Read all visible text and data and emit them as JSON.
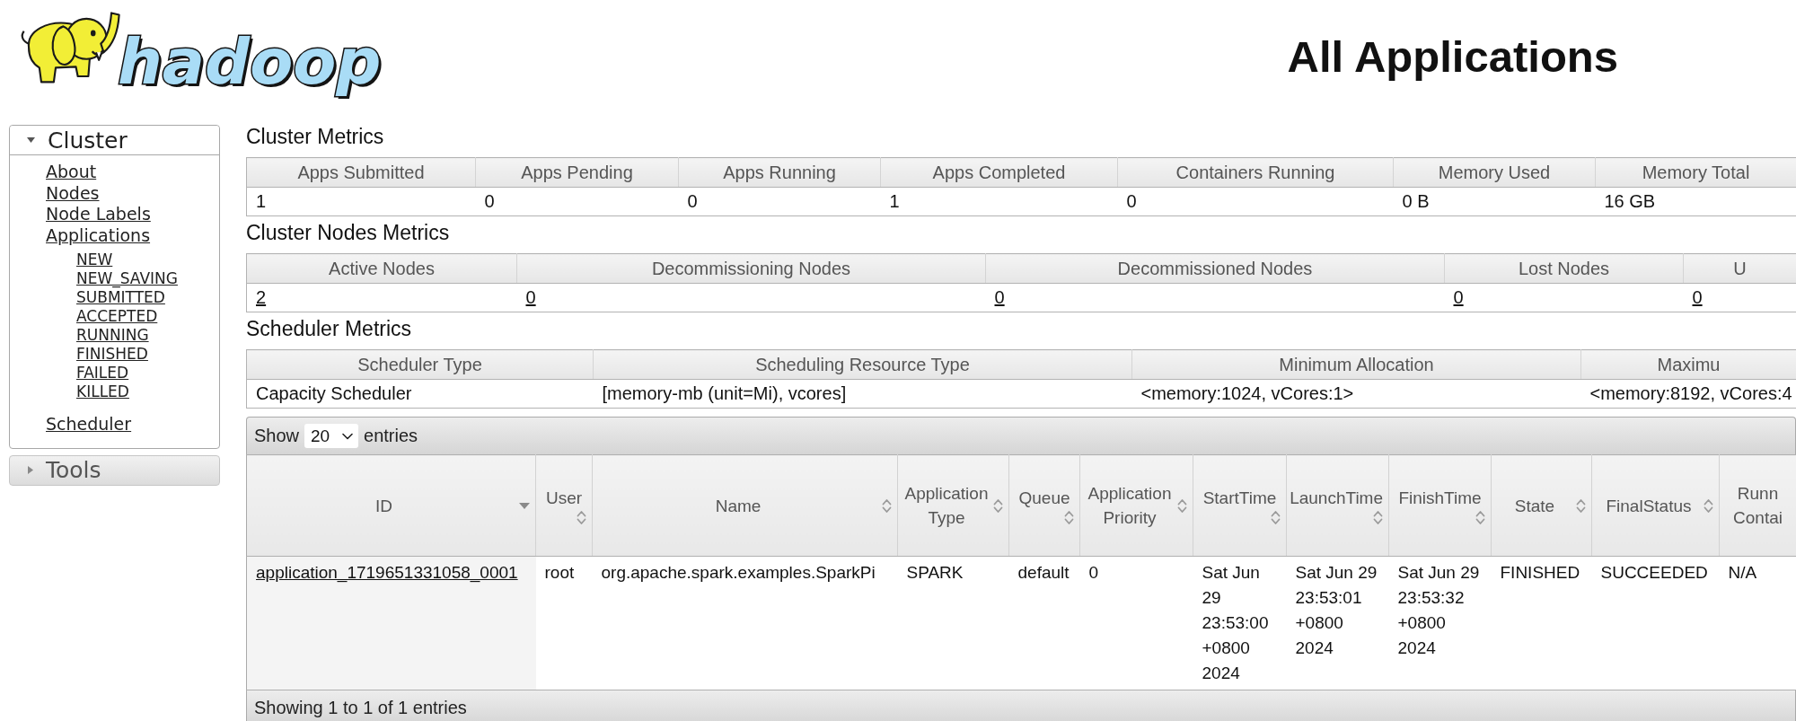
{
  "header": {
    "logo_text": "hadoop",
    "title": "All Applications"
  },
  "sidebar": {
    "sections": [
      {
        "title": "Cluster",
        "expanded": true,
        "items": [
          {
            "label": "About"
          },
          {
            "label": "Nodes"
          },
          {
            "label": "Node Labels"
          },
          {
            "label": "Applications",
            "children": [
              {
                "label": "NEW"
              },
              {
                "label": "NEW_SAVING"
              },
              {
                "label": "SUBMITTED"
              },
              {
                "label": "ACCEPTED"
              },
              {
                "label": "RUNNING"
              },
              {
                "label": "FINISHED"
              },
              {
                "label": "FAILED"
              },
              {
                "label": "KILLED"
              }
            ]
          },
          {
            "label": "Scheduler"
          }
        ]
      },
      {
        "title": "Tools",
        "expanded": false
      }
    ]
  },
  "metrics_tables": [
    {
      "title": "Cluster Metrics",
      "linked": false,
      "columns": [
        "Apps Submitted",
        "Apps Pending",
        "Apps Running",
        "Apps Completed",
        "Containers Running",
        "Memory Used",
        "Memory Total"
      ],
      "values": [
        "1",
        "0",
        "0",
        "1",
        "0",
        "0 B",
        "16 GB"
      ]
    },
    {
      "title": "Cluster Nodes Metrics",
      "linked": true,
      "columns": [
        "Active Nodes",
        "Decommissioning Nodes",
        "Decommissioned Nodes",
        "Lost Nodes",
        "U"
      ],
      "values": [
        "2",
        "0",
        "0",
        "0",
        "0"
      ]
    },
    {
      "title": "Scheduler Metrics",
      "linked": false,
      "columns": [
        "Scheduler Type",
        "Scheduling Resource Type",
        "Minimum Allocation",
        "Maximu"
      ],
      "values": [
        "Capacity Scheduler",
        "[memory-mb (unit=Mi), vcores]",
        "<memory:1024, vCores:1>",
        "<memory:8192, vCores:4"
      ]
    }
  ],
  "apps_table": {
    "length_menu": {
      "label": "Show",
      "value": "20",
      "suffix": "entries"
    },
    "columns": [
      {
        "label": "ID",
        "sorted": true,
        "link": true
      },
      {
        "label": "User",
        "sorted": false,
        "link": false
      },
      {
        "label": "Name",
        "sorted": false,
        "link": false
      },
      {
        "label": "Application Type",
        "sorted": false,
        "link": false
      },
      {
        "label": "Queue",
        "sorted": false,
        "link": false
      },
      {
        "label": "Application Priority",
        "sorted": false,
        "link": false
      },
      {
        "label": "StartTime",
        "sorted": false,
        "link": false
      },
      {
        "label": "LaunchTime",
        "sorted": false,
        "link": false
      },
      {
        "label": "FinishTime",
        "sorted": false,
        "link": false
      },
      {
        "label": "State",
        "sorted": false,
        "link": false
      },
      {
        "label": "FinalStatus",
        "sorted": false,
        "link": false
      },
      {
        "label": "Runn Contai",
        "link": false
      }
    ],
    "rows": [
      [
        "application_1719651331058_0001",
        "root",
        "org.apache.spark.examples.SparkPi",
        "SPARK",
        "default",
        "0",
        "Sat Jun 29 23:53:00 +0800 2024",
        "Sat Jun 29 23:53:01 +0800 2024",
        "Sat Jun 29 23:53:32 +0800 2024",
        "FINISHED",
        "SUCCEEDED",
        "N/A"
      ]
    ],
    "info": "Showing 1 to 1 of 1 entries"
  }
}
